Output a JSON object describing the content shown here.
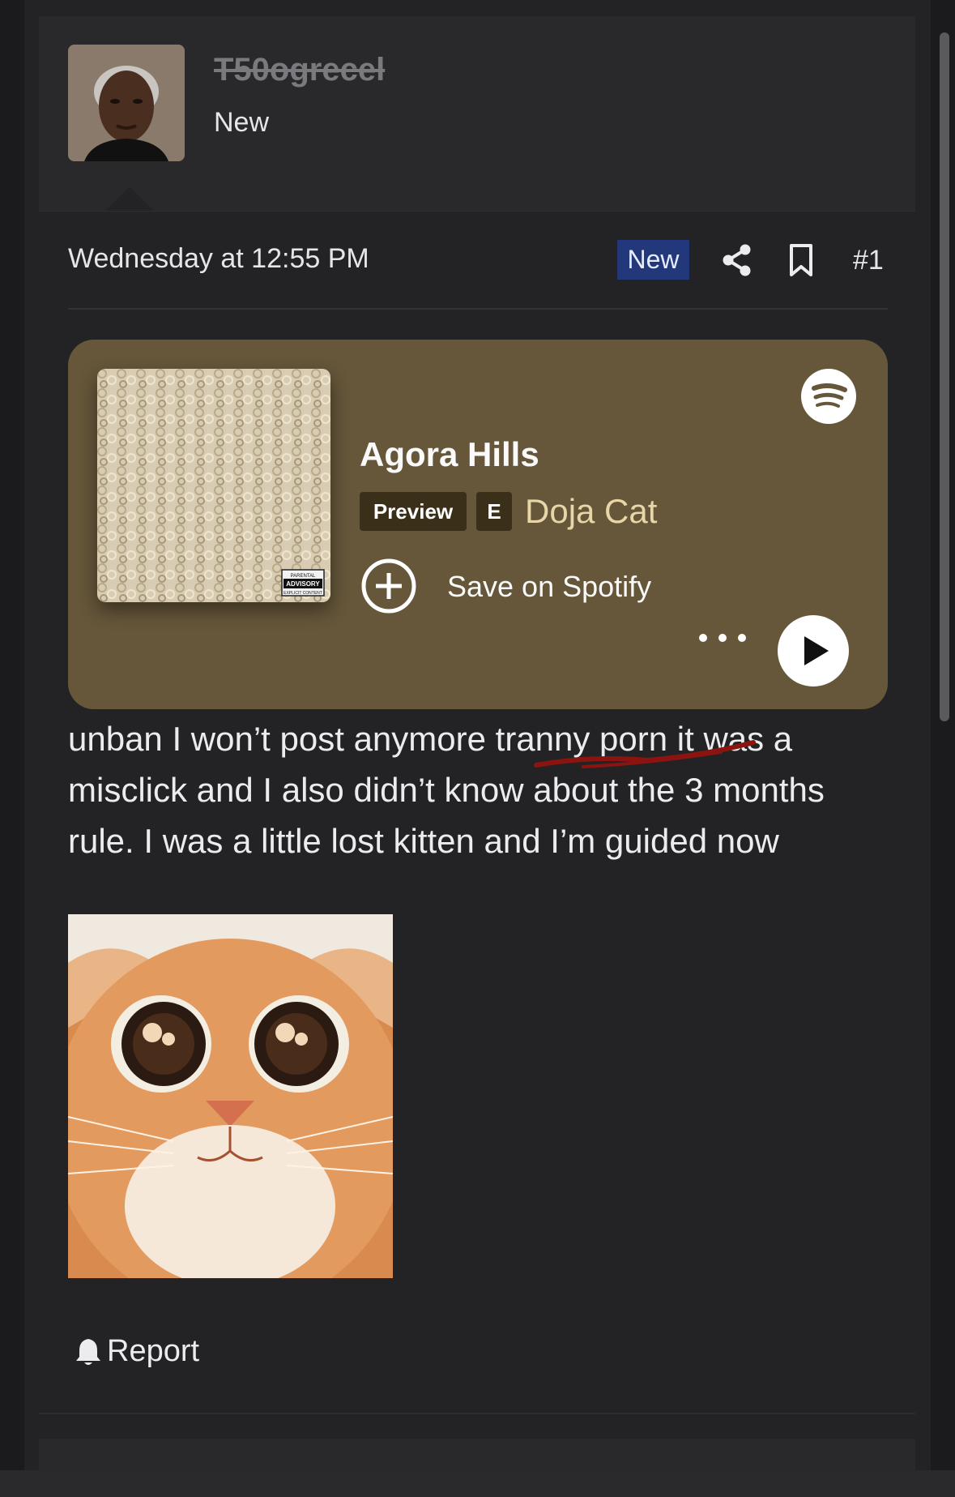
{
  "user": {
    "username": "T50ogrecel",
    "title": "New"
  },
  "post_meta": {
    "date": "Wednesday at 12:55 PM",
    "badge": "New",
    "number": "#1"
  },
  "spotify_embed": {
    "track": "Agora Hills",
    "preview_label": "Preview",
    "explicit_label": "E",
    "artist": "Doja Cat",
    "save_label": "Save on Spotify",
    "album_art_text": [
      "PARENTAL",
      "ADVISORY",
      "EXPLICIT CONTENT"
    ],
    "colors": {
      "card": "#66573a",
      "badge": "#3a2f18",
      "artist": "#e8d6a8"
    }
  },
  "message": {
    "text": "unban I won’t post anymore tranny porn it was a misclick and I also didn’t know about the 3 months rule. I was a little lost kitten and I’m guided now"
  },
  "actions": {
    "report_label": "Report"
  },
  "icons": [
    "share-icon",
    "bookmark-icon",
    "spotify-logo-icon",
    "plus-circle-icon",
    "more-icon",
    "play-icon",
    "bell-icon"
  ],
  "colors": {
    "background": "#1b1b1d",
    "post": "#232325",
    "new_badge": "#23387a"
  }
}
